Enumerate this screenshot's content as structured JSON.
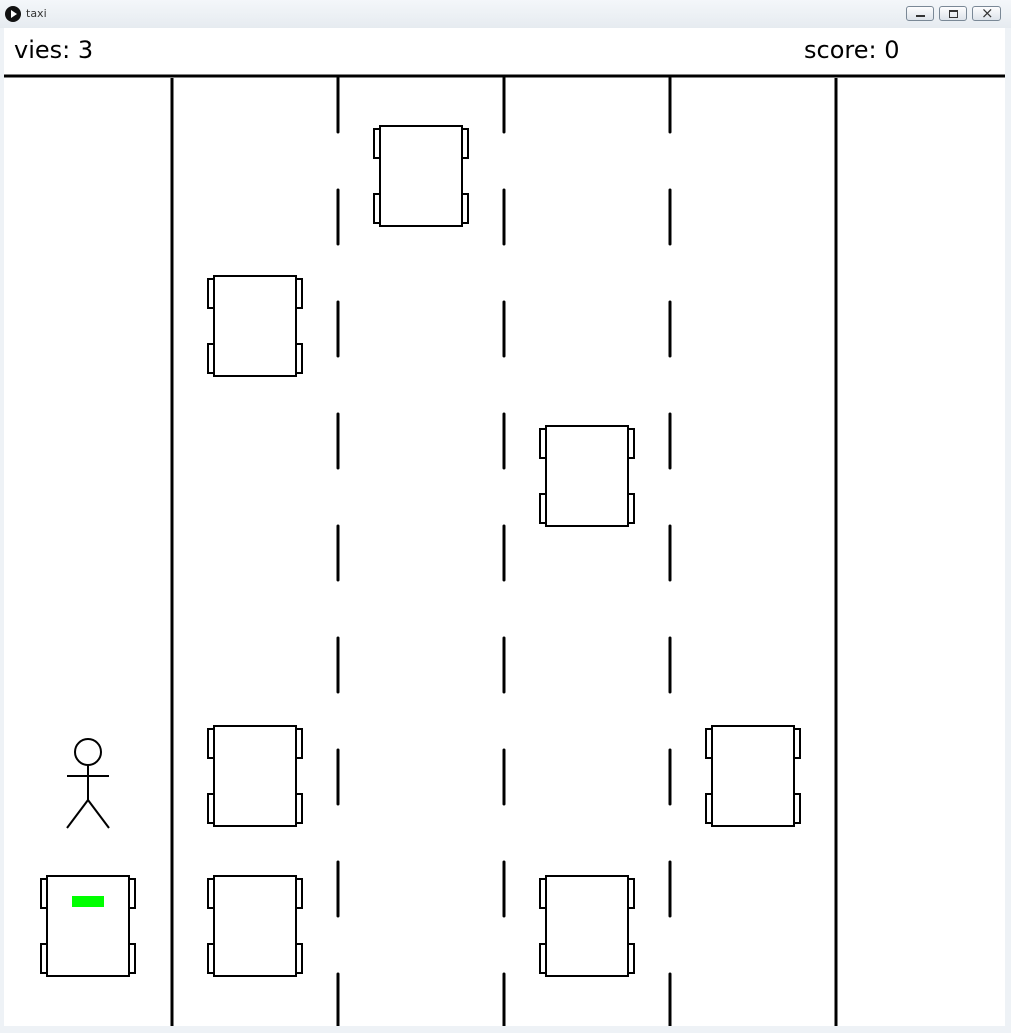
{
  "window": {
    "title": "taxi",
    "icon": "play-icon",
    "controls": [
      "minimize-icon",
      "maximize-icon",
      "close-icon"
    ]
  },
  "hud": {
    "lives_label": "vies: 3",
    "score_label": "score: 0",
    "lives": 3,
    "score": 0
  },
  "colors": {
    "background": "#ffffff",
    "stroke": "#000000",
    "taxi_sign": "#00ff00"
  },
  "road": {
    "lanes": 4,
    "traffic_cars": [
      {
        "lane": 1,
        "row": 0
      },
      {
        "lane": 0,
        "row": 1
      },
      {
        "lane": 2,
        "row": 2
      },
      {
        "lane": 0,
        "row": 5
      },
      {
        "lane": 3,
        "row": 5
      },
      {
        "lane": 0,
        "row": 6
      },
      {
        "lane": 2,
        "row": 6
      }
    ]
  },
  "player_taxi": {
    "lane": "sidewalk",
    "row": 6
  },
  "passenger": {
    "icon": "stick-figure",
    "row": 5
  }
}
